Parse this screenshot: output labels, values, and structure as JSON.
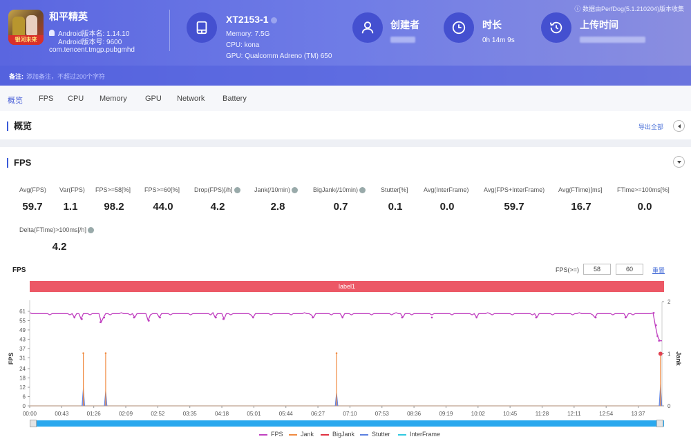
{
  "app": {
    "name": "和平精英",
    "android_version_name": "Android版本名: 1.14.10",
    "android_version_code": "Android版本号: 9600",
    "package": "com.tencent.tmgp.pubgmhd",
    "icon_badge_text": "银河未来"
  },
  "device": {
    "model": "XT2153-1",
    "memory": "Memory: 7.5G",
    "cpu": "CPU: kona",
    "gpu": "GPU: Qualcomm Adreno (TM) 650"
  },
  "meta": {
    "creator_label": "创建者",
    "duration_label": "时长",
    "duration_value": "0h 14m 9s",
    "upload_label": "上传时间",
    "source_note": "数据由PerfDog(5.1.210204)版本收集"
  },
  "note": {
    "label": "备注:",
    "placeholder": "添加备注，不超过200个字符"
  },
  "tabs": [
    {
      "label": "概览",
      "active": true
    },
    {
      "label": "FPS"
    },
    {
      "label": "CPU"
    },
    {
      "label": "Memory"
    },
    {
      "label": "GPU"
    },
    {
      "label": "Network"
    },
    {
      "label": "Battery"
    }
  ],
  "overview": {
    "title": "概览",
    "export_label": "导出全部"
  },
  "fps_section": {
    "title": "FPS",
    "stats": [
      {
        "label": "Avg(FPS)",
        "value": "59.7"
      },
      {
        "label": "Var(FPS)",
        "value": "1.1"
      },
      {
        "label": "FPS>=58[%]",
        "value": "98.2"
      },
      {
        "label": "FPS>=60[%]",
        "value": "44.0"
      },
      {
        "label": "Drop(FPS)[/h]",
        "value": "4.2",
        "help": true
      },
      {
        "label": "Jank(/10min)",
        "value": "2.8",
        "help": true
      },
      {
        "label": "BigJank(/10min)",
        "value": "0.7",
        "help": true
      },
      {
        "label": "Stutter[%]",
        "value": "0.1"
      },
      {
        "label": "Avg(InterFrame)",
        "value": "0.0"
      },
      {
        "label": "Avg(FPS+InterFrame)",
        "value": "59.7"
      },
      {
        "label": "Avg(FTime)[ms]",
        "value": "16.7"
      },
      {
        "label": "FTime>=100ms[%]",
        "value": "0.0"
      },
      {
        "label": "Delta(FTime)>100ms[/h]",
        "value": "4.2",
        "help": true
      }
    ]
  },
  "chart_controls": {
    "title": "FPS",
    "threshold_label": "FPS(>=)",
    "threshold_low": "58",
    "threshold_high": "60",
    "reset_label": "重置",
    "label_bar": "label1"
  },
  "chart_data": {
    "type": "line",
    "title": "FPS",
    "ylabel": "FPS",
    "y2label": "Jank",
    "y_ticks": [
      "0",
      "6",
      "12",
      "18",
      "24",
      "31",
      "37",
      "43",
      "49",
      "55",
      "61"
    ],
    "y_range": [
      0,
      61
    ],
    "y2_ticks": [
      "0",
      "1",
      "2"
    ],
    "y2_range": [
      0,
      2
    ],
    "x_ticks": [
      "00:00",
      "00:43",
      "01:26",
      "02:09",
      "02:52",
      "03:35",
      "04:18",
      "05:01",
      "05:44",
      "06:27",
      "07:10",
      "07:53",
      "08:36",
      "09:19",
      "10:02",
      "10:45",
      "11:28",
      "12:11",
      "12:54",
      "13:37"
    ],
    "x_range_seconds": [
      0,
      849
    ],
    "series": [
      {
        "name": "FPS",
        "color": "#c040c0",
        "baseline": 59.5,
        "dips": [
          [
            60,
            57
          ],
          [
            70,
            56
          ],
          [
            95,
            54
          ],
          [
            100,
            57
          ],
          [
            140,
            57
          ],
          [
            160,
            55
          ],
          [
            175,
            57
          ],
          [
            250,
            57
          ],
          [
            260,
            56
          ],
          [
            300,
            57
          ],
          [
            380,
            57
          ],
          [
            420,
            57
          ],
          [
            500,
            57
          ],
          [
            540,
            57
          ],
          [
            600,
            57
          ],
          [
            680,
            57
          ],
          [
            760,
            57
          ],
          [
            800,
            57
          ],
          [
            838,
            60
          ],
          [
            841,
            52
          ],
          [
            843,
            45
          ],
          [
            845,
            42
          ]
        ]
      },
      {
        "name": "Jank",
        "color": "#f08a40",
        "axis": "y2",
        "events": [
          [
            72,
            1
          ],
          [
            102,
            1
          ],
          [
            412,
            1
          ],
          [
            847,
            1
          ]
        ]
      },
      {
        "name": "BigJank",
        "color": "#e03040",
        "axis": "y2",
        "events": []
      },
      {
        "name": "Stutter",
        "color": "#5a80e0",
        "events": [
          [
            72,
            12
          ],
          [
            102,
            10
          ],
          [
            412,
            9
          ],
          [
            847,
            14
          ]
        ]
      },
      {
        "name": "InterFrame",
        "color": "#30c8e0",
        "events": []
      }
    ]
  }
}
